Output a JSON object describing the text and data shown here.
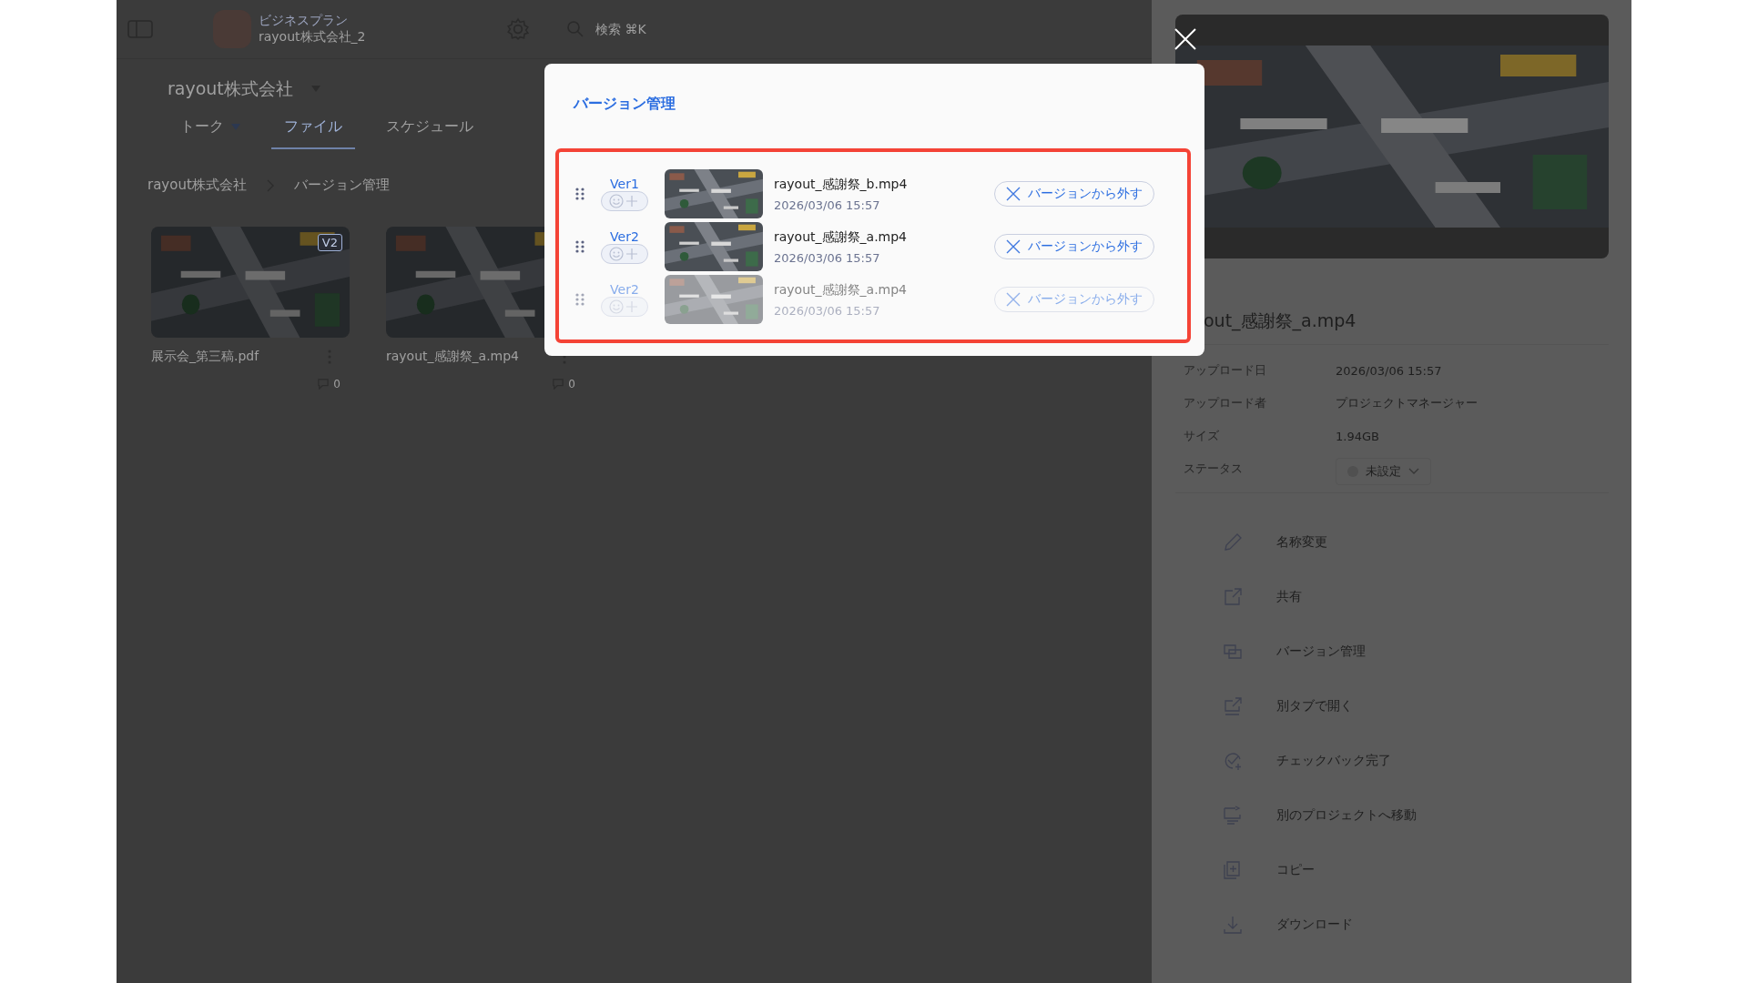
{
  "header": {
    "plan": "ビジネスプラン",
    "workspace": "rayout株式会社_2",
    "search_placeholder": "検索 ⌘K"
  },
  "project": {
    "title": "rayout株式会社"
  },
  "tabs": [
    {
      "label": "トーク",
      "selected": false,
      "dropdown": true
    },
    {
      "label": "ファイル",
      "selected": true,
      "dropdown": false
    },
    {
      "label": "スケジュール",
      "selected": false,
      "dropdown": false
    }
  ],
  "breadcrumb": [
    "rayout株式会社",
    "バージョン管理"
  ],
  "files": [
    {
      "name": "展示会_第三稿.pdf",
      "badge": "V2",
      "count": "0"
    },
    {
      "name": "rayout_感謝祭_a.mp4",
      "count": "0"
    }
  ],
  "dialog": {
    "title": "バージョン管理",
    "versions": [
      {
        "version": "Ver1",
        "name": "rayout_感謝祭_b.mp4",
        "date": "2026/03/06 15:57",
        "remove_label": "バージョンから外す",
        "ghost": false
      },
      {
        "version": "Ver2",
        "name": "rayout_感謝祭_a.mp4",
        "date": "2026/03/06 15:57",
        "remove_label": "バージョンから外す",
        "ghost": false
      },
      {
        "version": "Ver2",
        "name": "rayout_感謝祭_a.mp4",
        "date": "2026/03/06 15:57",
        "remove_label": "バージョンから外す",
        "ghost": true
      }
    ]
  },
  "details": {
    "file_name": "out_感謝祭_a.mp4",
    "fields": [
      {
        "label": "アップロード日",
        "value": "2026/03/06 15:57"
      },
      {
        "label": "アップロード者",
        "value": "プロジェクトマネージャー"
      },
      {
        "label": "サイズ",
        "value": "1.94GB"
      }
    ],
    "status": {
      "label": "ステータス",
      "value": "未設定"
    },
    "actions": [
      "名称変更",
      "共有",
      "バージョン管理",
      "別タブで開く",
      "チェックバック完了",
      "別のプロジェクトへ移動",
      "コピー",
      "ダウンロード"
    ]
  }
}
